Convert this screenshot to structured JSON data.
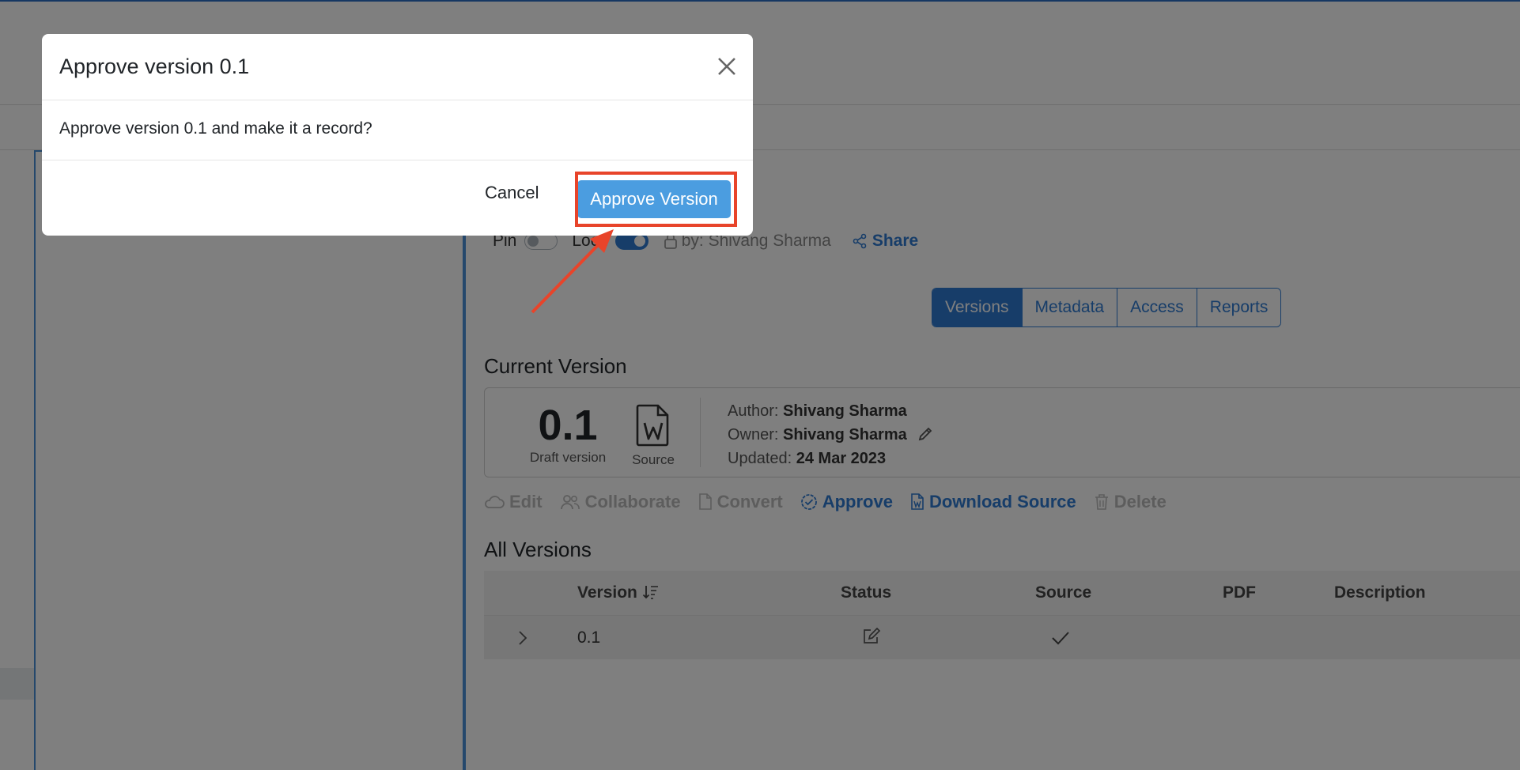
{
  "document": {
    "pin_label": "Pin",
    "lock_label": "Lock",
    "locked_by": "by: Shivang Sharma",
    "share_label": "Share",
    "pin_on": false,
    "lock_on": true
  },
  "tabs": [
    "Versions",
    "Metadata",
    "Access",
    "Reports"
  ],
  "active_tab": "Versions",
  "current_version": {
    "heading": "Current Version",
    "number": "0.1",
    "state": "Draft version",
    "source_label": "Source",
    "author_label": "Author:",
    "author": "Shivang Sharma",
    "owner_label": "Owner:",
    "owner": "Shivang Sharma",
    "updated_label": "Updated:",
    "updated": "24 Mar 2023"
  },
  "actions": {
    "edit": "Edit",
    "collaborate": "Collaborate",
    "convert": "Convert",
    "approve": "Approve",
    "download_source": "Download Source",
    "delete": "Delete"
  },
  "all_versions": {
    "heading": "All Versions",
    "columns": {
      "version": "Version",
      "status": "Status",
      "source": "Source",
      "pdf": "PDF",
      "description": "Description"
    },
    "rows": [
      {
        "version": "0.1",
        "status_icon": "edit-icon",
        "source_icon": "checkmark-icon"
      }
    ]
  },
  "modal": {
    "title": "Approve version 0.1",
    "message": "Approve version 0.1 and make it a record?",
    "cancel_label": "Cancel",
    "confirm_label": "Approve Version"
  },
  "colors": {
    "accent": "#2f7bd2",
    "confirm_button": "#4b9de0",
    "highlight": "#e8442a"
  }
}
